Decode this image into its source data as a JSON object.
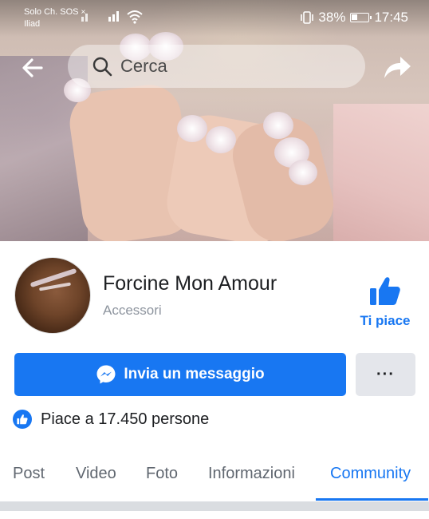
{
  "status_bar": {
    "carrier_line1": "Solo Ch. SOS",
    "carrier_x": "×",
    "carrier_line2": "Iliad",
    "battery_percent": "38%",
    "battery_level": 0.38,
    "time": "17:45"
  },
  "nav": {
    "back_icon": "arrow-left-icon",
    "search_placeholder": "Cerca",
    "share_icon": "share-arrow-icon"
  },
  "page": {
    "name": "Forcine Mon Amour",
    "category": "Accessori",
    "like_label": "Ti piace"
  },
  "actions": {
    "message_label": "Invia un messaggio",
    "more_label": "···"
  },
  "likes": {
    "text": "Piace a 17.450 persone"
  },
  "tabs": [
    {
      "label": "Post",
      "active": false
    },
    {
      "label": "Video",
      "active": false
    },
    {
      "label": "Foto",
      "active": false
    },
    {
      "label": "Informazioni",
      "active": false
    },
    {
      "label": "Community",
      "active": true
    }
  ],
  "colors": {
    "accent": "#1877f2",
    "secondary_button": "#e4e6eb",
    "muted_text": "#8d949e"
  }
}
